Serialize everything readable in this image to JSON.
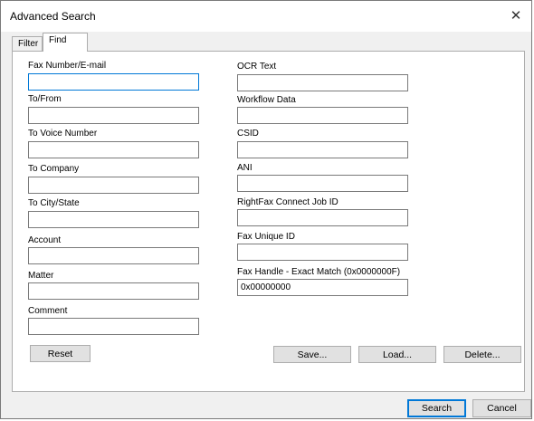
{
  "window": {
    "title": "Advanced Search",
    "close_glyph": "✕"
  },
  "tabs": [
    {
      "label": "Filter",
      "active": false
    },
    {
      "label": "Find",
      "active": true
    }
  ],
  "left_fields": [
    {
      "label": "Fax Number/E-mail",
      "value": ""
    },
    {
      "label": "To/From",
      "value": ""
    },
    {
      "label": "To Voice Number",
      "value": ""
    },
    {
      "label": "To Company",
      "value": ""
    },
    {
      "label": "To City/State",
      "value": ""
    },
    {
      "label": "Account",
      "value": ""
    },
    {
      "label": "Matter",
      "value": ""
    },
    {
      "label": "Comment",
      "value": ""
    }
  ],
  "right_fields": [
    {
      "label": "OCR Text",
      "value": ""
    },
    {
      "label": "Workflow Data",
      "value": ""
    },
    {
      "label": "CSID",
      "value": ""
    },
    {
      "label": "ANI",
      "value": ""
    },
    {
      "label": "RightFax Connect Job ID",
      "value": ""
    },
    {
      "label": "Fax Unique ID",
      "value": ""
    },
    {
      "label": "Fax Handle - Exact Match (0x0000000F)",
      "value": "0x00000000"
    }
  ],
  "buttons": {
    "reset": "Reset",
    "save": "Save...",
    "load": "Load...",
    "delete": "Delete...",
    "search": "Search",
    "cancel": "Cancel"
  },
  "colors": {
    "accent": "#0078d7",
    "button_face": "#e1e1e1",
    "dialog_bg": "#f0f0f0"
  }
}
